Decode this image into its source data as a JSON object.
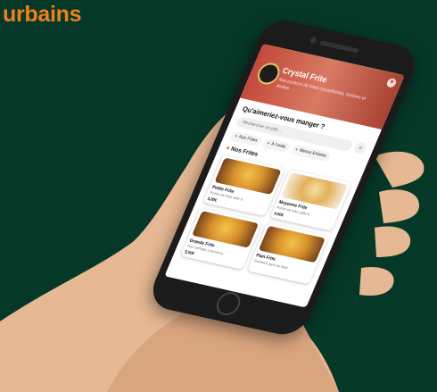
{
  "brand": {
    "text": "urbains"
  },
  "app": {
    "hero": {
      "title": "Crystal Frite",
      "subtitle": "Nos portions de frites croustillantes, fraîches et dorées"
    },
    "question": "Qu'aimeriez-vous manger ?",
    "search": {
      "placeholder": "Rechercher un plat..."
    },
    "chips": [
      {
        "label": "Nos Frites",
        "icon": "fries-icon"
      },
      {
        "label": "À l'unité",
        "icon": "burger-icon"
      },
      {
        "label": "Menus Enfants",
        "icon": "kids-icon"
      }
    ],
    "section_title": "Nos Frites",
    "products": [
      {
        "name": "Petite Frite",
        "desc": "Portion de frites taille S",
        "price": "3,00€"
      },
      {
        "name": "Moyenne Frite",
        "desc": "Portion de frites taille M",
        "price": "4,00€"
      },
      {
        "name": "Grande Frite",
        "desc": "Pour partager à plusieurs",
        "price": "5,00€"
      },
      {
        "name": "Pain Frite",
        "desc": "Sandwich garni de frites",
        "price": ""
      }
    ]
  },
  "colors": {
    "background": "#063827",
    "brand": "#f07f1c",
    "accent": "#e36b1c"
  }
}
